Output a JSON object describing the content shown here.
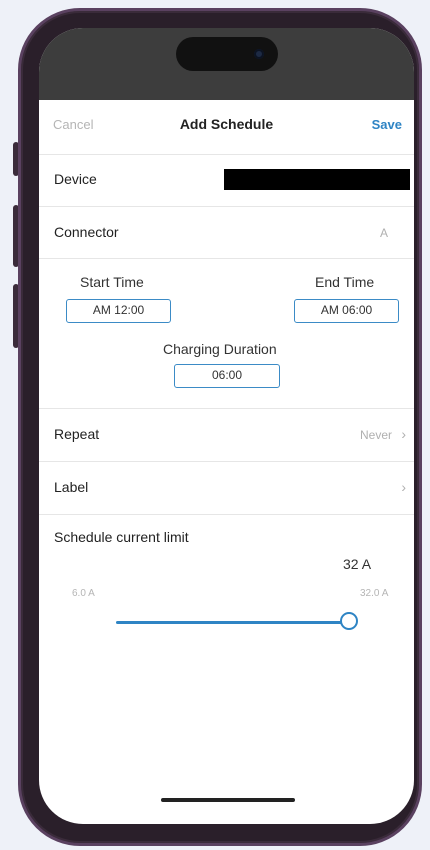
{
  "nav": {
    "cancel_label": "Cancel",
    "title": "Add Schedule",
    "save_label": "Save"
  },
  "device": {
    "label": "Device"
  },
  "connector": {
    "label": "Connector",
    "value": "A"
  },
  "schedule": {
    "start_label": "Start Time",
    "start_value": "AM 12:00",
    "end_label": "End Time",
    "end_value": "AM 06:00",
    "duration_label": "Charging Duration",
    "duration_value": "06:00"
  },
  "repeat": {
    "label": "Repeat",
    "value": "Never",
    "chevron": "›"
  },
  "label_row": {
    "label": "Label",
    "chevron": "›"
  },
  "current_limit": {
    "label": "Schedule current limit",
    "current_value": "32 A",
    "min_label": "6.0 A",
    "max_label": "32.0 A",
    "fraction": 1.0
  },
  "colors": {
    "accent": "#2e84c4",
    "phone_frame": "#5a4160"
  },
  "icons": {
    "camera": "camera-icon",
    "chevron": "chevron-right-icon"
  }
}
